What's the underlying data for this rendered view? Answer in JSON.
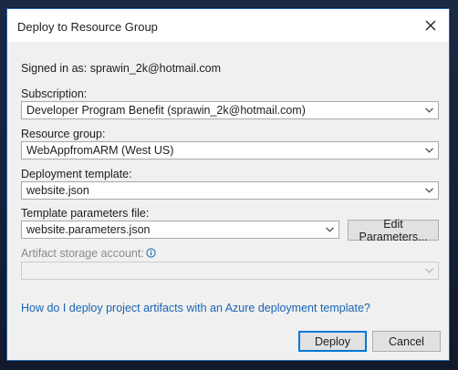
{
  "dialog": {
    "title": "Deploy to Resource Group",
    "signed_in": "Signed in as: sprawin_2k@hotmail.com"
  },
  "subscription": {
    "label": "Subscription:",
    "value": "Developer Program Benefit (sprawin_2k@hotmail.com)"
  },
  "resource_group": {
    "label": "Resource group:",
    "value": "WebAppfromARM (West US)"
  },
  "deployment_template": {
    "label": "Deployment template:",
    "value": "website.json"
  },
  "template_parameters": {
    "label": "Template parameters file:",
    "value": "website.parameters.json",
    "edit_button": "Edit Parameters..."
  },
  "artifact_storage": {
    "label": "Artifact storage account:",
    "value": "",
    "enabled": false
  },
  "help_link": "How do I deploy project artifacts with an Azure deployment template?",
  "buttons": {
    "deploy": "Deploy",
    "cancel": "Cancel"
  },
  "colors": {
    "link": "#1a64b4",
    "accent_border": "#0078d7",
    "info_icon": "#1a64b4"
  }
}
